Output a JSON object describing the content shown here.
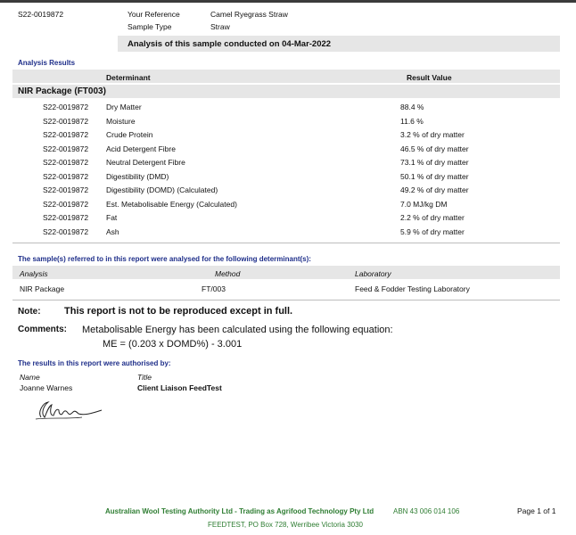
{
  "header": {
    "lab_number": "S22-0019872",
    "your_reference_label": "Your Reference",
    "your_reference_value": "Camel Ryegrass Straw",
    "sample_type_label": "Sample Type",
    "sample_type_value": "Straw",
    "analysis_banner": "Analysis of this sample conducted on 04-Mar-2022"
  },
  "results": {
    "section_title": "Analysis Results",
    "col_determinant": "Determinant",
    "col_result": "Result Value",
    "package_title": "NIR Package  (FT003)",
    "rows": [
      {
        "id": "S22-0019872",
        "name": "Dry Matter",
        "value": "88.4 %"
      },
      {
        "id": "S22-0019872",
        "name": "Moisture",
        "value": "11.6 %"
      },
      {
        "id": "S22-0019872",
        "name": "Crude Protein",
        "value": "3.2 % of dry matter"
      },
      {
        "id": "S22-0019872",
        "name": "Acid Detergent Fibre",
        "value": "46.5 % of dry matter"
      },
      {
        "id": "S22-0019872",
        "name": "Neutral Detergent Fibre",
        "value": "73.1 % of dry matter"
      },
      {
        "id": "S22-0019872",
        "name": "Digestibility (DMD)",
        "value": "50.1 % of dry matter"
      },
      {
        "id": "S22-0019872",
        "name": "Digestibility (DOMD) (Calculated)",
        "value": "49.2 % of dry matter"
      },
      {
        "id": "S22-0019872",
        "name": "Est. Metabolisable Energy (Calculated)",
        "value": "7.0 MJ/kg DM"
      },
      {
        "id": "S22-0019872",
        "name": "Fat",
        "value": "2.2 % of dry matter"
      },
      {
        "id": "S22-0019872",
        "name": "Ash",
        "value": "5.9 % of dry matter"
      }
    ]
  },
  "methods": {
    "section_title": "The sample(s) referred to in this report were analysed for the following determinant(s):",
    "col_analysis": "Analysis",
    "col_method": "Method",
    "col_laboratory": "Laboratory",
    "analysis": "NIR Package",
    "method": "FT/003",
    "laboratory": "Feed & Fodder Testing Laboratory"
  },
  "note": {
    "label": "Note:",
    "text": "This report is not to be reproduced except in full."
  },
  "comments": {
    "label": "Comments:",
    "line1": "Metabolisable Energy has been calculated using the following equation:",
    "line2": "ME = (0.203 x DOMD%) - 3.001"
  },
  "authorisation": {
    "section_title": "The results in this report were authorised by:",
    "col_name": "Name",
    "col_title": "Title",
    "name": "Joanne Warnes",
    "title": "Client Liaison FeedTest",
    "signature": "JWarnes"
  },
  "footer": {
    "company": "Australian Wool Testing Authority Ltd - Trading as Agrifood Technology Pty Ltd",
    "abn": "ABN 43 006 014 106",
    "address": "FEEDTEST, PO Box 728, Werribee  Victoria  3030",
    "page": "Page 1 of 1"
  },
  "colors": {
    "heading_navy": "#1f2f8a",
    "footer_green": "#2e7d32",
    "bar_grey": "#e6e6e6"
  }
}
